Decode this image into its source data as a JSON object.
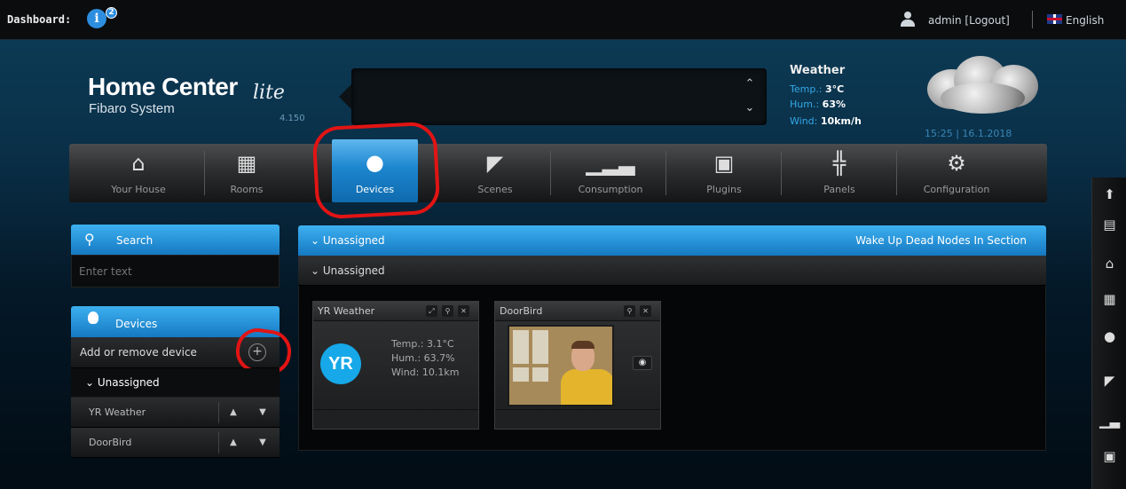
{
  "topbar": {
    "dashboard_label": "Dashboard:",
    "info_icon": "i",
    "notification_count": "2",
    "user": "admin [Logout]",
    "language": "English"
  },
  "header": {
    "logo_main": "Home Center",
    "logo_lite": "lite",
    "logo_sub": "Fibaro System",
    "version": "4.150",
    "ticker_up": "⌃",
    "ticker_down": "⌄"
  },
  "weather": {
    "title": "Weather",
    "temp_label": "Temp.:",
    "temp_value": "3°C",
    "hum_label": "Hum.:",
    "hum_value": "63%",
    "wind_label": "Wind:",
    "wind_value": "10km/h",
    "datetime": "15:25 | 16.1.2018"
  },
  "nav": {
    "items": [
      {
        "label": "Your House",
        "icon": "house-icon"
      },
      {
        "label": "Rooms",
        "icon": "rooms-icon"
      },
      {
        "label": "Devices",
        "icon": "bulb-icon",
        "active": true
      },
      {
        "label": "Scenes",
        "icon": "clapperboard-icon"
      },
      {
        "label": "Consumption",
        "icon": "chart-icon"
      },
      {
        "label": "Plugins",
        "icon": "plugin-icon"
      },
      {
        "label": "Panels",
        "icon": "panels-icon"
      },
      {
        "label": "Configuration",
        "icon": "gear-icon"
      }
    ]
  },
  "sidebar": {
    "search_title": "Search",
    "search_placeholder": "Enter text",
    "devices_title": "Devices",
    "add_remove": "Add or remove device",
    "add_button": "+",
    "unassigned": "Unassigned",
    "devices": [
      {
        "label": "YR Weather"
      },
      {
        "label": "DoorBird"
      }
    ]
  },
  "main": {
    "section_title": "Unassigned",
    "wake_up": "Wake Up Dead Nodes In Section",
    "sub_title": "Unassigned",
    "cards": [
      {
        "name": "YR Weather",
        "logo": "YR",
        "temp": "Temp.: 3.1°C",
        "hum": "Hum.: 63.7%",
        "wind": "Wind: 10.1km"
      },
      {
        "name": "DoorBird"
      }
    ]
  },
  "colors": {
    "accent": "#1c86cf",
    "highlight_annotation": "#e21414"
  }
}
